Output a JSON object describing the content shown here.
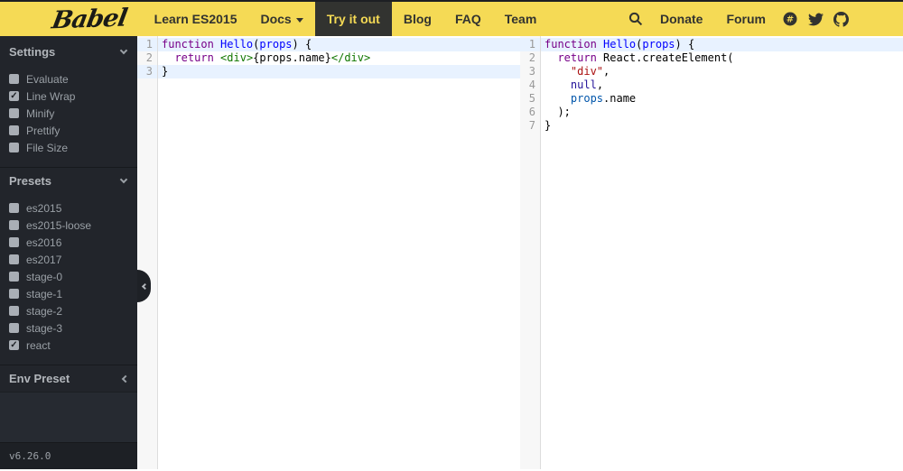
{
  "navbar": {
    "logo": "Babel",
    "links": [
      {
        "label": "Learn ES2015",
        "active": false
      },
      {
        "label": "Docs",
        "active": false,
        "caret": true
      },
      {
        "label": "Try it out",
        "active": true
      },
      {
        "label": "Blog",
        "active": false
      },
      {
        "label": "FAQ",
        "active": false
      },
      {
        "label": "Team",
        "active": false
      }
    ],
    "right_links": [
      {
        "label": "Donate"
      },
      {
        "label": "Forum"
      }
    ],
    "icons": [
      "search-icon",
      "slack-icon",
      "twitter-icon",
      "github-icon"
    ],
    "colors": {
      "background": "#f5da55",
      "text": "#323330",
      "active_bg": "#323330",
      "active_text": "#f5da55"
    }
  },
  "sidebar": {
    "sections": [
      {
        "title": "Settings",
        "items": [
          {
            "label": "Evaluate",
            "checked": false
          },
          {
            "label": "Line Wrap",
            "checked": true
          },
          {
            "label": "Minify",
            "checked": false
          },
          {
            "label": "Prettify",
            "checked": false
          },
          {
            "label": "File Size",
            "checked": false
          }
        ]
      },
      {
        "title": "Presets",
        "items": [
          {
            "label": "es2015",
            "checked": false
          },
          {
            "label": "es2015-loose",
            "checked": false
          },
          {
            "label": "es2016",
            "checked": false
          },
          {
            "label": "es2017",
            "checked": false
          },
          {
            "label": "stage-0",
            "checked": false
          },
          {
            "label": "stage-1",
            "checked": false
          },
          {
            "label": "stage-2",
            "checked": false
          },
          {
            "label": "stage-3",
            "checked": false
          },
          {
            "label": "react",
            "checked": true
          }
        ]
      }
    ],
    "env_preset": {
      "title": "Env Preset"
    },
    "version": "v6.26.0",
    "colors": {
      "background": "#22252b",
      "text": "#9aa0a6"
    }
  },
  "editors": {
    "source": {
      "lines": [
        {
          "num": "1",
          "hl": true,
          "tokens": [
            [
              "keyword",
              "function"
            ],
            [
              "plain",
              " "
            ],
            [
              "def",
              "Hello"
            ],
            [
              "plain",
              "("
            ],
            [
              "def",
              "props"
            ],
            [
              "plain",
              ") {"
            ]
          ]
        },
        {
          "num": "2",
          "hl": false,
          "tokens": [
            [
              "plain",
              "  "
            ],
            [
              "keyword",
              "return"
            ],
            [
              "plain",
              " "
            ],
            [
              "tag",
              "<div>"
            ],
            [
              "plain",
              "{props.name}"
            ],
            [
              "tag",
              "</div>"
            ]
          ]
        },
        {
          "num": "3",
          "hl": true,
          "tokens": [
            [
              "plain",
              "}"
            ]
          ]
        }
      ]
    },
    "output": {
      "lines": [
        {
          "num": "1",
          "hl": true,
          "tokens": [
            [
              "keyword",
              "function"
            ],
            [
              "plain",
              " "
            ],
            [
              "def",
              "Hello"
            ],
            [
              "plain",
              "("
            ],
            [
              "def",
              "props"
            ],
            [
              "plain",
              ") {"
            ]
          ]
        },
        {
          "num": "2",
          "hl": false,
          "tokens": [
            [
              "plain",
              "  "
            ],
            [
              "keyword",
              "return"
            ],
            [
              "plain",
              " React.createElement("
            ]
          ]
        },
        {
          "num": "3",
          "hl": false,
          "tokens": [
            [
              "plain",
              "    "
            ],
            [
              "string",
              "\"div\""
            ],
            [
              "plain",
              ","
            ]
          ]
        },
        {
          "num": "4",
          "hl": false,
          "tokens": [
            [
              "plain",
              "    "
            ],
            [
              "atom",
              "null"
            ],
            [
              "plain",
              ","
            ]
          ]
        },
        {
          "num": "5",
          "hl": false,
          "tokens": [
            [
              "plain",
              "    "
            ],
            [
              "variable2",
              "props"
            ],
            [
              "plain",
              ".name"
            ]
          ]
        },
        {
          "num": "6",
          "hl": false,
          "tokens": [
            [
              "plain",
              "  );"
            ]
          ]
        },
        {
          "num": "7",
          "hl": false,
          "tokens": [
            [
              "plain",
              "}"
            ]
          ]
        }
      ]
    }
  },
  "syntax_colors": {
    "keyword": "#770088",
    "def": "#0000ff",
    "tag": "#117700",
    "string": "#aa1111",
    "atom": "#221199",
    "variable2": "#0055aa",
    "plain": "#000000",
    "line_highlight": "#e8f2ff"
  }
}
